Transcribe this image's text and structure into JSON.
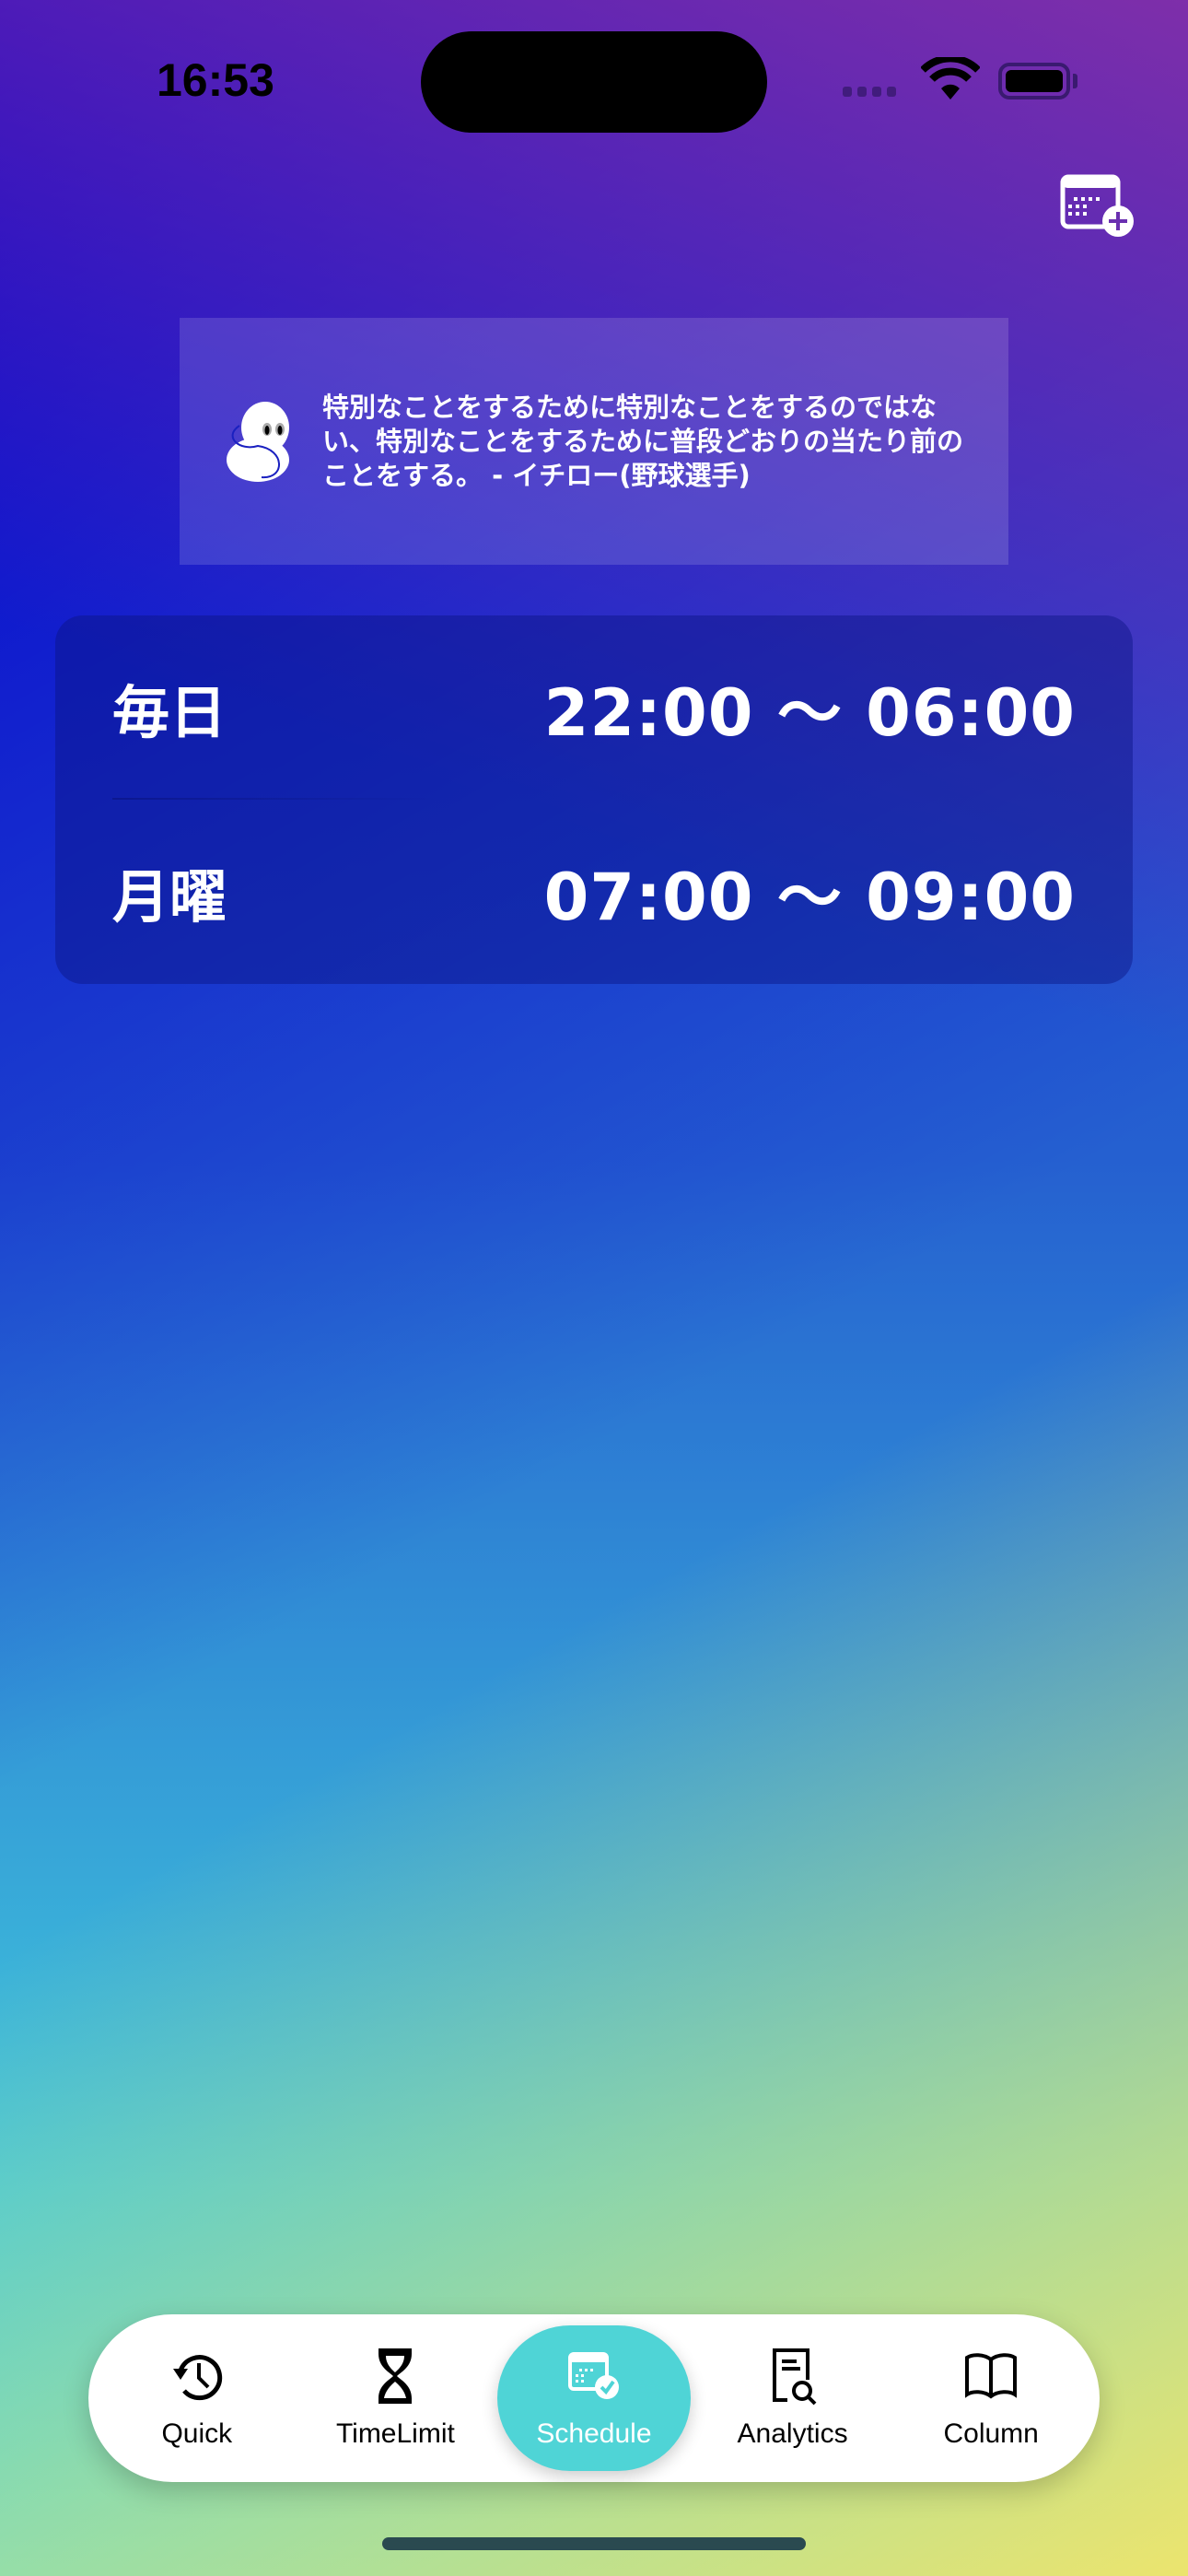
{
  "status_bar": {
    "time": "16:53"
  },
  "header": {
    "add_schedule_icon": "calendar-plus-icon"
  },
  "quote": {
    "text": "特別なことをするために特別なことをするのではない、特別なことをするために普段どおりの当たり前のことをする。 - イチロー(野球選手)",
    "mascot_icon": "ghost-mascot-icon"
  },
  "schedules": [
    {
      "day": "毎日",
      "time": "22:00 〜 06:00"
    },
    {
      "day": "月曜",
      "time": "07:00 〜 09:00"
    }
  ],
  "tabbar": {
    "active": "Schedule",
    "active_color": "#4fd4d6",
    "tabs": [
      {
        "label": "Quick",
        "icon": "clock-history-icon"
      },
      {
        "label": "TimeLimit",
        "icon": "hourglass-icon"
      },
      {
        "label": "Schedule",
        "icon": "calendar-check-icon"
      },
      {
        "label": "Analytics",
        "icon": "document-search-icon"
      },
      {
        "label": "Column",
        "icon": "book-icon"
      }
    ]
  }
}
